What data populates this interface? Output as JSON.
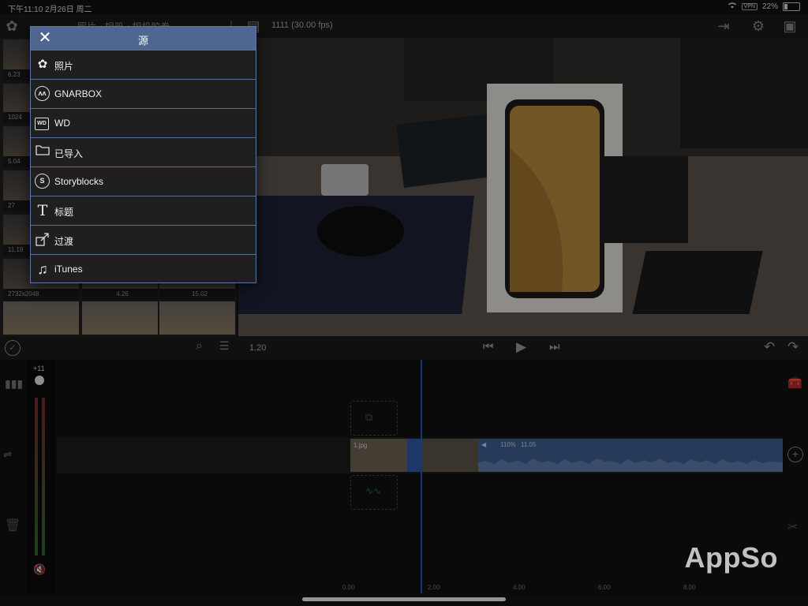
{
  "status": {
    "time_date": "下午11:10  2月26日 周二",
    "vpn": "VPN",
    "battery": "22%"
  },
  "topbar": {
    "breadcrumb": "照片 ‹ 相册 ‹ 相机胶卷",
    "project_info": "1111  (30.00 fps)"
  },
  "browser": {
    "captions": [
      "6.23",
      "1024",
      "5.04",
      "27",
      "11.19",
      "2732x2048",
      "4.26",
      "15.02"
    ]
  },
  "popup": {
    "title": "源",
    "items": [
      {
        "label": "照片",
        "icon": "flower-icon"
      },
      {
        "label": "GNARBOX",
        "icon": "gnarbox-icon"
      },
      {
        "label": "WD",
        "icon": "wd-icon"
      },
      {
        "label": "已导入",
        "icon": "folder-icon"
      },
      {
        "label": "Storyblocks",
        "icon": "storyblocks-icon"
      },
      {
        "label": "标题",
        "icon": "title-t-icon"
      },
      {
        "label": "过渡",
        "icon": "transition-icon"
      },
      {
        "label": "iTunes",
        "icon": "music-note-icon"
      }
    ]
  },
  "transport": {
    "time": "1.20"
  },
  "timeline": {
    "meter_level": "+11",
    "clip_label": "1.jpg",
    "audio_volume": "110%",
    "audio_duration": "11.05",
    "ruler": [
      "0.00",
      "2.00",
      "4.00",
      "6.00",
      "8.00"
    ]
  },
  "watermark": "AppSo",
  "colors": {
    "accent": "#4e6690",
    "clip_blue": "#3e5f93",
    "playhead": "#2f5ba8"
  }
}
